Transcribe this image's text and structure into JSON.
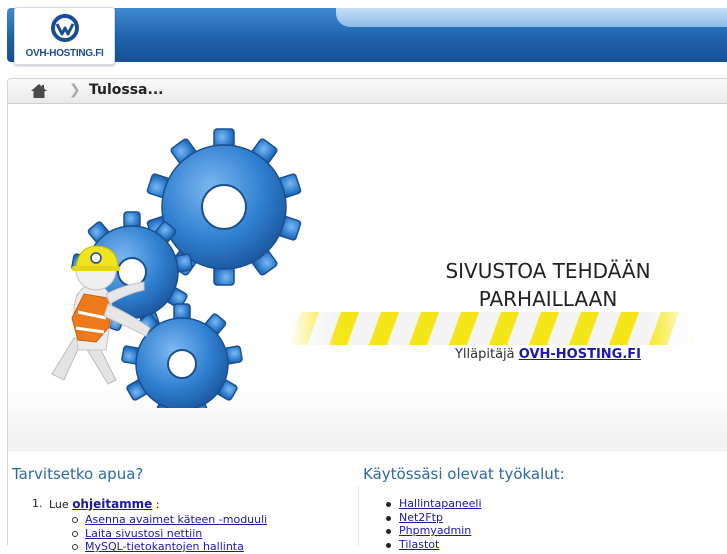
{
  "header": {
    "logo_text": "OVH-HOSTING.FI"
  },
  "breadcrumb": {
    "title": "Tulossa..."
  },
  "hero": {
    "headline_line1": "SIVUSTOA TEHDÄÄN",
    "headline_line2": "PARHAILLAAN",
    "host_prefix": "Ylläpitäjä",
    "host_link": "OVH-HOSTING.FI"
  },
  "help": {
    "heading": "Tarvitsetko apua?",
    "lead_number": "1.",
    "lead_prefix": "Lue",
    "lead_link": "ohjeitamme",
    "lead_suffix": ":",
    "items": [
      "Asenna avaimet käteen -moduuli",
      "Laita sivustosi nettiin",
      "MySQL-tietokantojen hallinta"
    ]
  },
  "tools": {
    "heading": "Käytössäsi olevat työkalut:",
    "items": [
      "Hallintapaneeli",
      "Net2Ftp",
      "Phpmyadmin",
      "Tilastot"
    ]
  },
  "colors": {
    "header_blue": "#1f63ad",
    "heading_blue": "#2a6aa8",
    "link_blue": "#1a1aa6",
    "gear_blue": "#2f7fd0",
    "hazard_yellow": "#f5e61a"
  },
  "icons": {
    "home": "home-icon",
    "separator": "chevron-right-icon",
    "logo": "ovh-logo-icon"
  }
}
